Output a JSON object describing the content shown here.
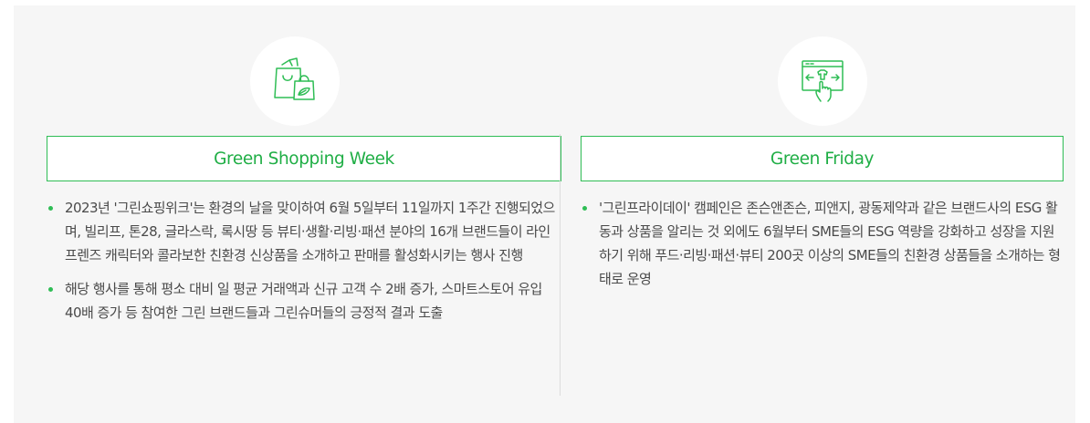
{
  "sections": [
    {
      "title": "Green Shopping Week",
      "icon": "shopping-bags-icon",
      "bullets": [
        "2023년 '그린쇼핑위크'는 환경의 날을 맞이하여 6월 5일부터 11일까지 1주간 진행되었으며, 빌리프, 톤28, 글라스락, 록시땅 등 뷰티·생활·리빙·패션 분야의 16개 브랜드들이 라인프렌즈 캐릭터와 콜라보한 친환경 신상품을 소개하고 판매를 활성화시키는 행사 진행",
        "해당 행사를 통해 평소 대비 일 평균 거래액과 신규 고객 수 2배 증가, 스마트스토어 유입 40배 증가 등 참여한 그린 브랜드들과 그린슈머들의 긍정적 결과 도출"
      ]
    },
    {
      "title": "Green Friday",
      "icon": "browser-hand-click-icon",
      "bullets": [
        "'그린프라이데이' 캠페인은 존슨앤존슨, 피앤지, 광동제약과 같은 브랜드사의 ESG 활동과 상품을 알리는 것 외에도 6월부터 SME들의 ESG 역량을 강화하고 성장을 지원하기 위해 푸드·리빙·패션·뷰티 200곳 이상의 SME들의 친환경 상품들을 소개하는 형태로 운영"
      ]
    }
  ],
  "colors": {
    "accent": "#2fbd55",
    "panel_bg": "#f6f6f6",
    "text": "#4a4a4a"
  }
}
